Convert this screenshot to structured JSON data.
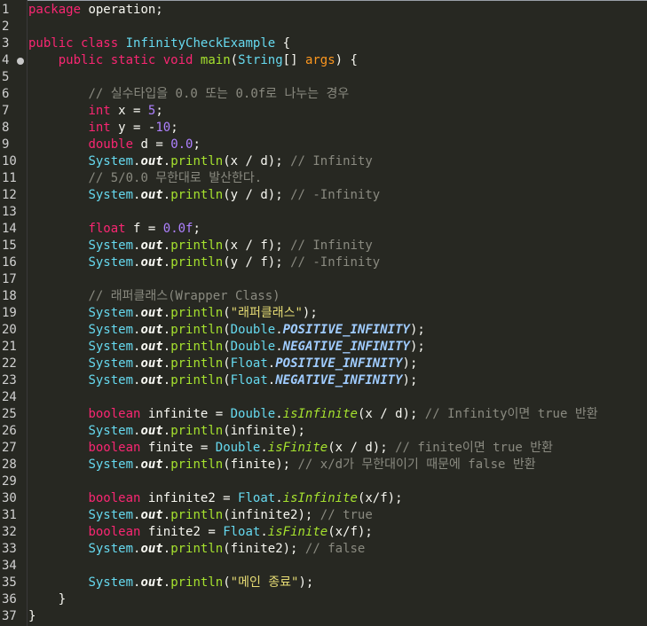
{
  "editor": {
    "language": "java",
    "colors": {
      "background": "#272822",
      "keyword": "#f92672",
      "type": "#66d9ef",
      "method": "#a6e22e",
      "number": "#ae81ff",
      "comment": "#8a8a80",
      "string": "#e6db74",
      "constant": "#a0ccff"
    },
    "gutter_markers": [
      4
    ]
  },
  "lines": [
    {
      "n": "1",
      "tokens": [
        [
          "kw",
          "package"
        ],
        [
          "pl",
          " operation;"
        ]
      ]
    },
    {
      "n": "2",
      "tokens": []
    },
    {
      "n": "3",
      "tokens": [
        [
          "kw",
          "public"
        ],
        [
          "pl",
          " "
        ],
        [
          "kw",
          "class"
        ],
        [
          "pl",
          " "
        ],
        [
          "cls",
          "InfinityCheckExample"
        ],
        [
          "pl",
          " {"
        ]
      ]
    },
    {
      "n": "4",
      "tokens": [
        [
          "pl",
          "    "
        ],
        [
          "kw",
          "public"
        ],
        [
          "pl",
          " "
        ],
        [
          "kw",
          "static"
        ],
        [
          "pl",
          " "
        ],
        [
          "kw",
          "void"
        ],
        [
          "pl",
          " "
        ],
        [
          "fn",
          "main"
        ],
        [
          "pl",
          "("
        ],
        [
          "cls",
          "String"
        ],
        [
          "pl",
          "[] "
        ],
        [
          "param",
          "args"
        ],
        [
          "pl",
          ") {"
        ]
      ]
    },
    {
      "n": "5",
      "tokens": []
    },
    {
      "n": "6",
      "tokens": [
        [
          "pl",
          "        "
        ],
        [
          "cm",
          "// 실수타입을 0.0 또는 0.0f로 나누는 경우"
        ]
      ]
    },
    {
      "n": "7",
      "tokens": [
        [
          "pl",
          "        "
        ],
        [
          "kw",
          "int"
        ],
        [
          "pl",
          " "
        ],
        [
          "var",
          "x"
        ],
        [
          "pl",
          " = "
        ],
        [
          "num",
          "5"
        ],
        [
          "pl",
          ";"
        ]
      ]
    },
    {
      "n": "8",
      "tokens": [
        [
          "pl",
          "        "
        ],
        [
          "kw",
          "int"
        ],
        [
          "pl",
          " "
        ],
        [
          "var",
          "y"
        ],
        [
          "pl",
          " = -"
        ],
        [
          "num",
          "10"
        ],
        [
          "pl",
          ";"
        ]
      ]
    },
    {
      "n": "9",
      "tokens": [
        [
          "pl",
          "        "
        ],
        [
          "kw",
          "double"
        ],
        [
          "pl",
          " "
        ],
        [
          "var",
          "d"
        ],
        [
          "pl",
          " = "
        ],
        [
          "num",
          "0.0"
        ],
        [
          "pl",
          ";"
        ]
      ]
    },
    {
      "n": "10",
      "tokens": [
        [
          "pl",
          "        "
        ],
        [
          "cls",
          "System"
        ],
        [
          "pl",
          "."
        ],
        [
          "fld",
          "out"
        ],
        [
          "pl",
          "."
        ],
        [
          "fn",
          "println"
        ],
        [
          "pl",
          "(x / d); "
        ],
        [
          "cm",
          "// Infinity"
        ]
      ]
    },
    {
      "n": "11",
      "tokens": [
        [
          "pl",
          "        "
        ],
        [
          "cm",
          "// 5/0.0 무한대로 발산한다."
        ]
      ]
    },
    {
      "n": "12",
      "tokens": [
        [
          "pl",
          "        "
        ],
        [
          "cls",
          "System"
        ],
        [
          "pl",
          "."
        ],
        [
          "fld",
          "out"
        ],
        [
          "pl",
          "."
        ],
        [
          "fn",
          "println"
        ],
        [
          "pl",
          "(y / d); "
        ],
        [
          "cm",
          "// -Infinity"
        ]
      ]
    },
    {
      "n": "13",
      "tokens": []
    },
    {
      "n": "14",
      "tokens": [
        [
          "pl",
          "        "
        ],
        [
          "kw",
          "float"
        ],
        [
          "pl",
          " "
        ],
        [
          "var",
          "f"
        ],
        [
          "pl",
          " = "
        ],
        [
          "num",
          "0.0f"
        ],
        [
          "pl",
          ";"
        ]
      ]
    },
    {
      "n": "15",
      "tokens": [
        [
          "pl",
          "        "
        ],
        [
          "cls",
          "System"
        ],
        [
          "pl",
          "."
        ],
        [
          "fld",
          "out"
        ],
        [
          "pl",
          "."
        ],
        [
          "fn",
          "println"
        ],
        [
          "pl",
          "(x / f); "
        ],
        [
          "cm",
          "// Infinity"
        ]
      ]
    },
    {
      "n": "16",
      "tokens": [
        [
          "pl",
          "        "
        ],
        [
          "cls",
          "System"
        ],
        [
          "pl",
          "."
        ],
        [
          "fld",
          "out"
        ],
        [
          "pl",
          "."
        ],
        [
          "fn",
          "println"
        ],
        [
          "pl",
          "(y / f); "
        ],
        [
          "cm",
          "// -Infinity"
        ]
      ]
    },
    {
      "n": "17",
      "tokens": []
    },
    {
      "n": "18",
      "tokens": [
        [
          "pl",
          "        "
        ],
        [
          "cm",
          "// 래퍼클래스(Wrapper Class)"
        ]
      ]
    },
    {
      "n": "19",
      "tokens": [
        [
          "pl",
          "        "
        ],
        [
          "cls",
          "System"
        ],
        [
          "pl",
          "."
        ],
        [
          "fld",
          "out"
        ],
        [
          "pl",
          "."
        ],
        [
          "fn",
          "println"
        ],
        [
          "pl",
          "("
        ],
        [
          "str",
          "\"래퍼클래스\""
        ],
        [
          "pl",
          ");"
        ]
      ]
    },
    {
      "n": "20",
      "tokens": [
        [
          "pl",
          "        "
        ],
        [
          "cls",
          "System"
        ],
        [
          "pl",
          "."
        ],
        [
          "fld",
          "out"
        ],
        [
          "pl",
          "."
        ],
        [
          "fn",
          "println"
        ],
        [
          "pl",
          "("
        ],
        [
          "cls",
          "Double"
        ],
        [
          "pl",
          "."
        ],
        [
          "const",
          "POSITIVE_INFINITY"
        ],
        [
          "pl",
          ");"
        ]
      ]
    },
    {
      "n": "21",
      "tokens": [
        [
          "pl",
          "        "
        ],
        [
          "cls",
          "System"
        ],
        [
          "pl",
          "."
        ],
        [
          "fld",
          "out"
        ],
        [
          "pl",
          "."
        ],
        [
          "fn",
          "println"
        ],
        [
          "pl",
          "("
        ],
        [
          "cls",
          "Double"
        ],
        [
          "pl",
          "."
        ],
        [
          "const",
          "NEGATIVE_INFINITY"
        ],
        [
          "pl",
          ");"
        ]
      ]
    },
    {
      "n": "22",
      "tokens": [
        [
          "pl",
          "        "
        ],
        [
          "cls",
          "System"
        ],
        [
          "pl",
          "."
        ],
        [
          "fld",
          "out"
        ],
        [
          "pl",
          "."
        ],
        [
          "fn",
          "println"
        ],
        [
          "pl",
          "("
        ],
        [
          "cls",
          "Float"
        ],
        [
          "pl",
          "."
        ],
        [
          "const",
          "POSITIVE_INFINITY"
        ],
        [
          "pl",
          ");"
        ]
      ]
    },
    {
      "n": "23",
      "tokens": [
        [
          "pl",
          "        "
        ],
        [
          "cls",
          "System"
        ],
        [
          "pl",
          "."
        ],
        [
          "fld",
          "out"
        ],
        [
          "pl",
          "."
        ],
        [
          "fn",
          "println"
        ],
        [
          "pl",
          "("
        ],
        [
          "cls",
          "Float"
        ],
        [
          "pl",
          "."
        ],
        [
          "const",
          "NEGATIVE_INFINITY"
        ],
        [
          "pl",
          ");"
        ]
      ]
    },
    {
      "n": "24",
      "tokens": []
    },
    {
      "n": "25",
      "tokens": [
        [
          "pl",
          "        "
        ],
        [
          "kw",
          "boolean"
        ],
        [
          "pl",
          " "
        ],
        [
          "var",
          "infinite"
        ],
        [
          "pl",
          " = "
        ],
        [
          "cls",
          "Double"
        ],
        [
          "pl",
          "."
        ],
        [
          "smeth",
          "isInfinite"
        ],
        [
          "pl",
          "(x / d); "
        ],
        [
          "cm",
          "// Infinity이면 true 반환"
        ]
      ]
    },
    {
      "n": "26",
      "tokens": [
        [
          "pl",
          "        "
        ],
        [
          "cls",
          "System"
        ],
        [
          "pl",
          "."
        ],
        [
          "fld",
          "out"
        ],
        [
          "pl",
          "."
        ],
        [
          "fn",
          "println"
        ],
        [
          "pl",
          "(infinite);"
        ]
      ]
    },
    {
      "n": "27",
      "tokens": [
        [
          "pl",
          "        "
        ],
        [
          "kw",
          "boolean"
        ],
        [
          "pl",
          " "
        ],
        [
          "var",
          "finite"
        ],
        [
          "pl",
          " = "
        ],
        [
          "cls",
          "Double"
        ],
        [
          "pl",
          "."
        ],
        [
          "smeth",
          "isFinite"
        ],
        [
          "pl",
          "(x / d); "
        ],
        [
          "cm",
          "// finite이면 true 반환"
        ]
      ]
    },
    {
      "n": "28",
      "tokens": [
        [
          "pl",
          "        "
        ],
        [
          "cls",
          "System"
        ],
        [
          "pl",
          "."
        ],
        [
          "fld",
          "out"
        ],
        [
          "pl",
          "."
        ],
        [
          "fn",
          "println"
        ],
        [
          "pl",
          "(finite); "
        ],
        [
          "cm",
          "// x/d가 무한대이기 때문에 false 반환"
        ]
      ]
    },
    {
      "n": "29",
      "tokens": []
    },
    {
      "n": "30",
      "tokens": [
        [
          "pl",
          "        "
        ],
        [
          "kw",
          "boolean"
        ],
        [
          "pl",
          " "
        ],
        [
          "var",
          "infinite2"
        ],
        [
          "pl",
          " = "
        ],
        [
          "cls",
          "Float"
        ],
        [
          "pl",
          "."
        ],
        [
          "smeth",
          "isInfinite"
        ],
        [
          "pl",
          "(x/f);"
        ]
      ]
    },
    {
      "n": "31",
      "tokens": [
        [
          "pl",
          "        "
        ],
        [
          "cls",
          "System"
        ],
        [
          "pl",
          "."
        ],
        [
          "fld",
          "out"
        ],
        [
          "pl",
          "."
        ],
        [
          "fn",
          "println"
        ],
        [
          "pl",
          "(infinite2); "
        ],
        [
          "cm",
          "// true"
        ]
      ]
    },
    {
      "n": "32",
      "tokens": [
        [
          "pl",
          "        "
        ],
        [
          "kw",
          "boolean"
        ],
        [
          "pl",
          " "
        ],
        [
          "var",
          "finite2"
        ],
        [
          "pl",
          " = "
        ],
        [
          "cls",
          "Float"
        ],
        [
          "pl",
          "."
        ],
        [
          "smeth",
          "isFinite"
        ],
        [
          "pl",
          "(x/f);"
        ]
      ]
    },
    {
      "n": "33",
      "tokens": [
        [
          "pl",
          "        "
        ],
        [
          "cls",
          "System"
        ],
        [
          "pl",
          "."
        ],
        [
          "fld",
          "out"
        ],
        [
          "pl",
          "."
        ],
        [
          "fn",
          "println"
        ],
        [
          "pl",
          "(finite2); "
        ],
        [
          "cm",
          "// false"
        ]
      ]
    },
    {
      "n": "34",
      "tokens": []
    },
    {
      "n": "35",
      "tokens": [
        [
          "pl",
          "        "
        ],
        [
          "cls",
          "System"
        ],
        [
          "pl",
          "."
        ],
        [
          "fld",
          "out"
        ],
        [
          "pl",
          "."
        ],
        [
          "fn",
          "println"
        ],
        [
          "pl",
          "("
        ],
        [
          "str",
          "\"메인 종료\""
        ],
        [
          "pl",
          ");"
        ]
      ]
    },
    {
      "n": "36",
      "tokens": [
        [
          "pl",
          "    }"
        ]
      ]
    },
    {
      "n": "37",
      "tokens": [
        [
          "pl",
          "}"
        ]
      ]
    }
  ]
}
